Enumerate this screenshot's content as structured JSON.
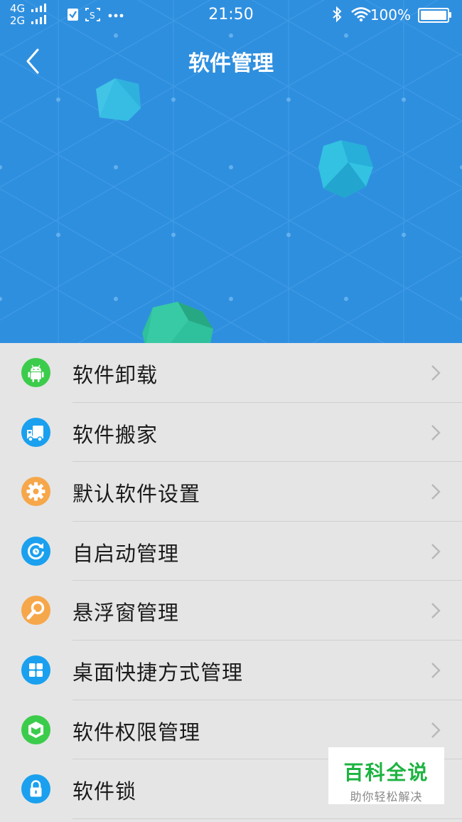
{
  "status_bar": {
    "network_top": "4G",
    "network_bottom": "2G",
    "time": "21:50",
    "battery": "100%",
    "battery_level": 1.0,
    "icons_left": [
      "sim-signal-icon",
      "clipboard-check-icon",
      "screenshot-icon",
      "more-icon"
    ],
    "icons_right": [
      "bluetooth-icon",
      "wifi-icon",
      "battery-icon"
    ]
  },
  "header": {
    "title": "软件管理",
    "back_icon": "chevron-left-icon",
    "background_color": "#2f8fdf"
  },
  "menu": {
    "items": [
      {
        "label": "软件卸载",
        "icon": "android-icon",
        "color": "#3ccc4c"
      },
      {
        "label": "软件搬家",
        "icon": "truck-icon",
        "color": "#1aa0ef"
      },
      {
        "label": "默认软件设置",
        "icon": "gear-icon",
        "color": "#f6a74a"
      },
      {
        "label": "自启动管理",
        "icon": "autostart-icon",
        "color": "#1aa0ef"
      },
      {
        "label": "悬浮窗管理",
        "icon": "magnifier-icon",
        "color": "#f6a74a"
      },
      {
        "label": "桌面快捷方式管理",
        "icon": "grid-icon",
        "color": "#1aa0ef"
      },
      {
        "label": "软件权限管理",
        "icon": "shield-box-icon",
        "color": "#3ccc4c"
      },
      {
        "label": "软件锁",
        "icon": "lock-icon",
        "color": "#1aa0ef"
      }
    ]
  },
  "watermark": {
    "title": "百科全说",
    "subtitle": "助你轻松解决"
  }
}
